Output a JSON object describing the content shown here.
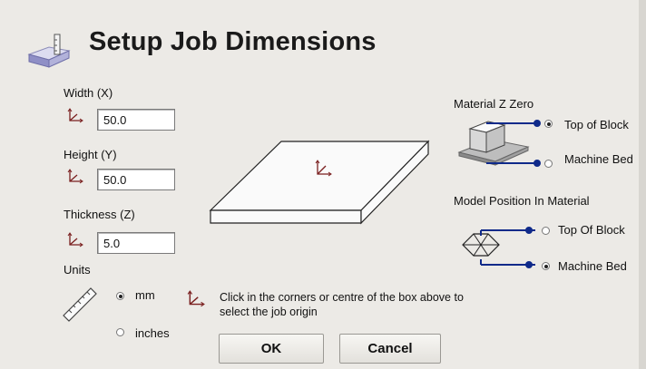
{
  "title": "Setup Job Dimensions",
  "width": {
    "label": "Width (X)",
    "value": "50.0"
  },
  "height": {
    "label": "Height (Y)",
    "value": "50.0"
  },
  "thickness": {
    "label": "Thickness (Z)",
    "value": "5.0"
  },
  "units": {
    "label": "Units",
    "options": [
      {
        "label": "mm",
        "selected": true
      },
      {
        "label": "inches",
        "selected": false
      }
    ]
  },
  "origin_hint": "Click in the corners or centre of the box above to select the job origin",
  "material_z_zero": {
    "label": "Material Z Zero",
    "options": [
      {
        "label": "Top of Block",
        "selected": true
      },
      {
        "label": "Machine Bed",
        "selected": false
      }
    ]
  },
  "model_position": {
    "label": "Model Position In Material",
    "options": [
      {
        "label": "Top Of Block",
        "selected": false
      },
      {
        "label": "Machine Bed",
        "selected": true
      }
    ]
  },
  "buttons": {
    "ok": "OK",
    "cancel": "Cancel"
  },
  "colors": {
    "accent_blue": "#0f2a8a",
    "origin_icon": "#7a1f1f",
    "background": "#eceae6"
  },
  "icons": [
    "block-icon",
    "origin-axis-icon",
    "ruler-icon",
    "block-top-diagram-icon",
    "wireframe-cube-icon"
  ]
}
